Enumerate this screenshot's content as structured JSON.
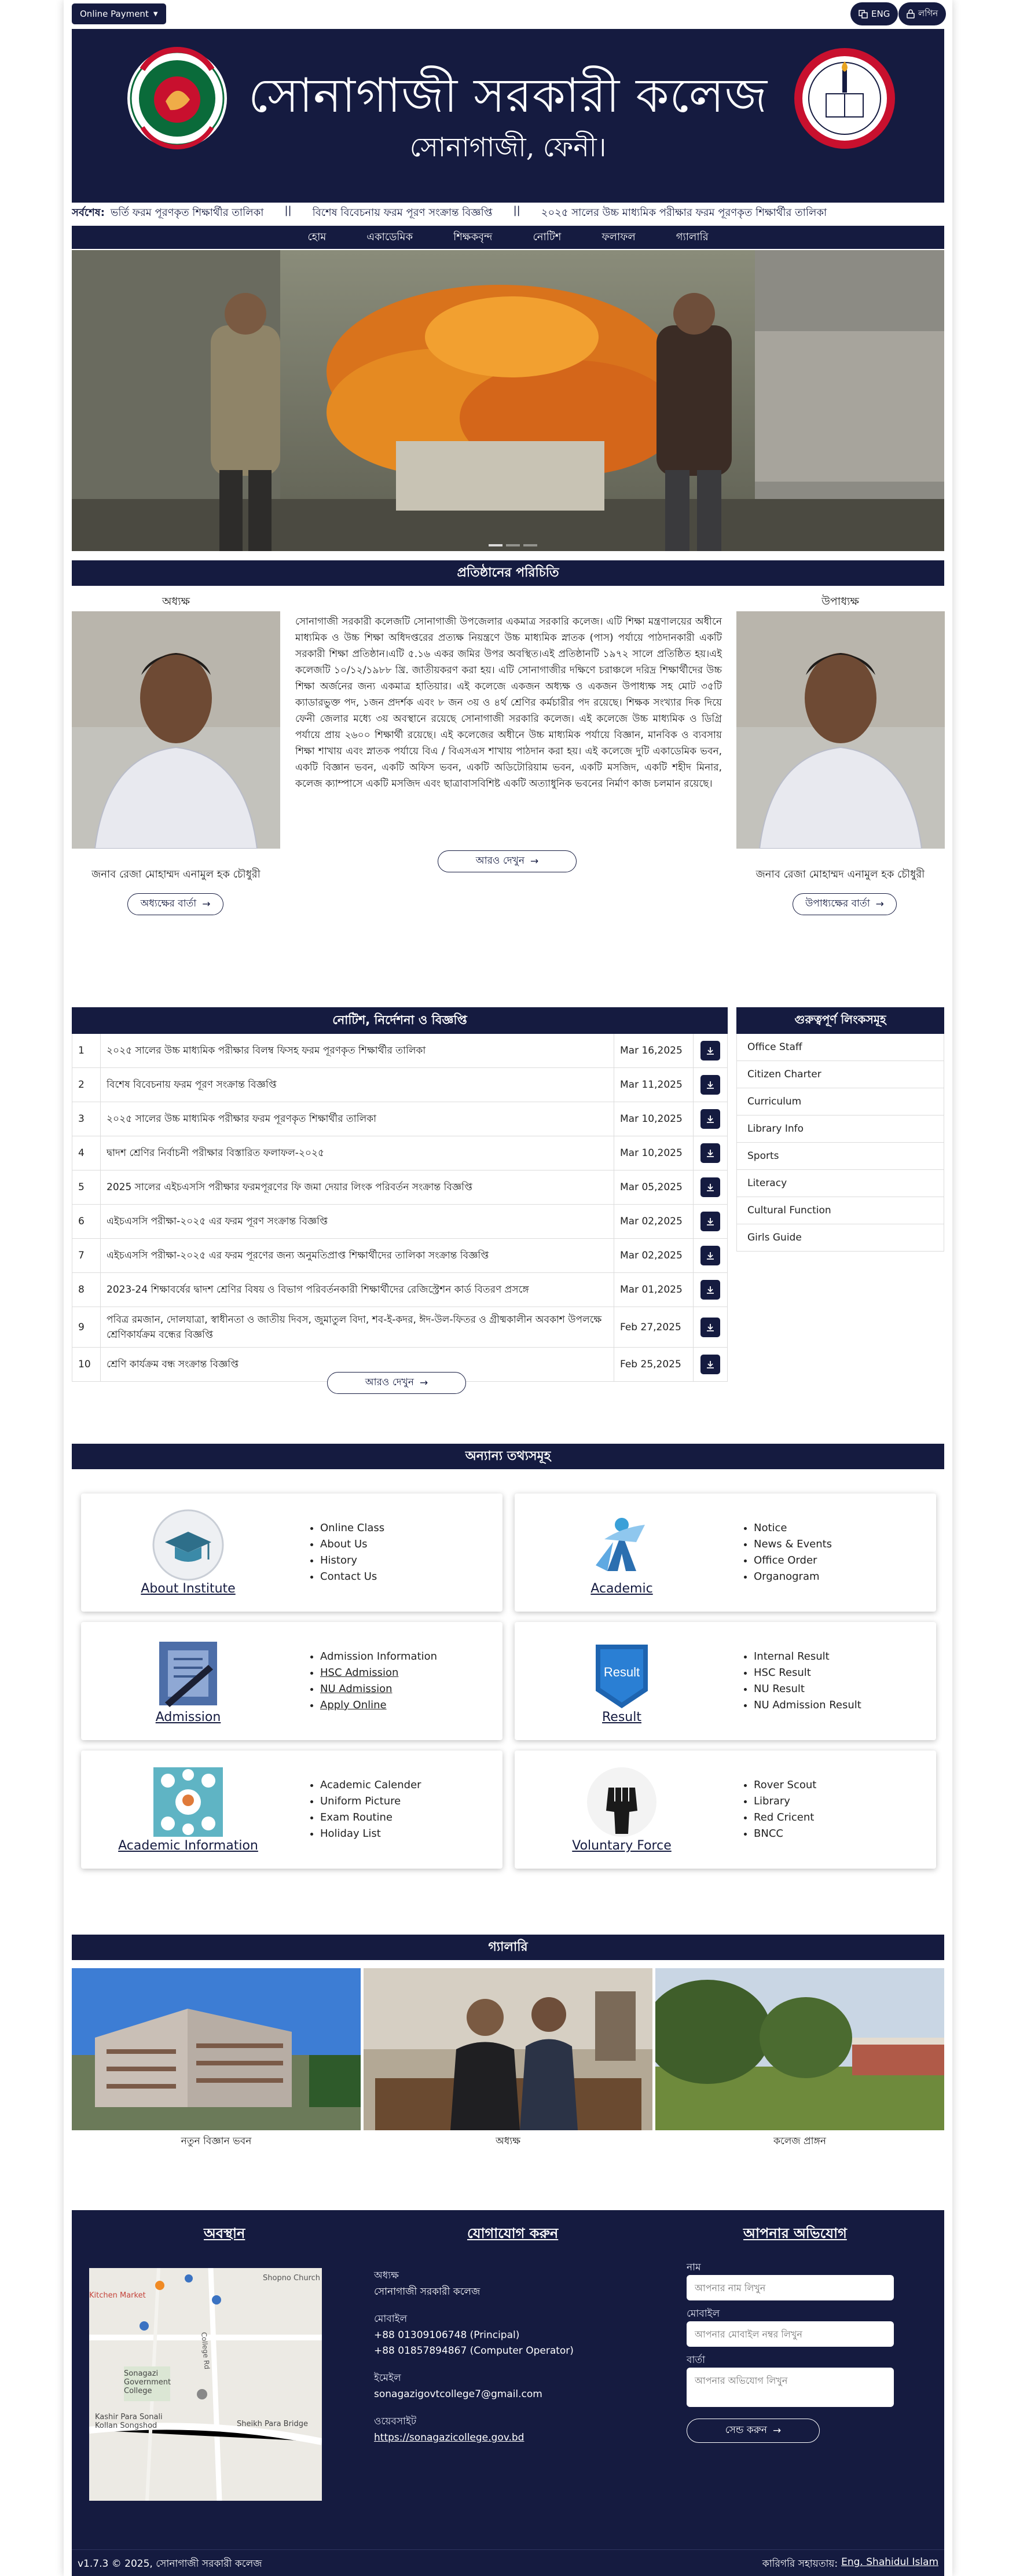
{
  "topbar": {
    "payment_label": "Online Payment",
    "lang_label": "ENG",
    "login_label": "লগিন"
  },
  "header": {
    "title": "সোনাগাজী সরকারী কলেজ",
    "subtitle": "সোনাগাজী, ফেনী।"
  },
  "ticker": {
    "label": "সর্বশেষ:",
    "items": [
      "ভর্তি ফরম পূরণকৃত শিক্ষার্থীর তালিকা",
      "||",
      "বিশেষ বিবেচনায় ফরম পূরণ সংক্রান্ত বিজ্ঞপ্তি",
      "||",
      "২০২৫ সালের উচ্চ মাধ্যমিক পরীক্ষার ফরম পূরণকৃত শিক্ষার্থীর তালিকা"
    ]
  },
  "menu": [
    "হোম",
    "একাডেমিক",
    "শিক্ষকবৃন্দ",
    "নোটিশ",
    "ফলাফল",
    "গ্যালারি"
  ],
  "intro": {
    "section_title": "প্রতিষ্ঠানের পরিচিতি",
    "principal": {
      "role": "অধ্যক্ষ",
      "name": "জনাব রেজা মোহাম্মদ এনামুল হক চৌধুরী",
      "button": "অধ্যক্ষের বার্তা"
    },
    "vice_principal": {
      "role": "উপাধ্যক্ষ",
      "name": "জনাব রেজা মোহাম্মদ এনামুল হক চৌধুরী",
      "button": "উপাধ্যক্ষের বার্তা"
    },
    "text": "সোনাগাজী সরকারী কলেজটি সোনাগাজী উপজেলার একমাত্র সরকারি কলেজ। এটি শিক্ষা মন্ত্রণালয়ের অধীনে মাধ্যমিক ও উচ্চ শিক্ষা অধিদপ্তরের প্রত্যক্ষ নিয়ন্ত্রণে উচ্চ মাধ্যমিক স্নাতক (পাস) পর্যায়ে পাঠদানকারী একটি সরকারী শিক্ষা প্রতিষ্ঠান।এটি ৫.১৬ একর জমির উপর অবস্থিত।এই প্রতিষ্ঠানটি ১৯৭২ সালে প্রতিষ্ঠিত হয়।এই কলেজটি ১০/১২/১৯৮৮ খ্রি. জাতীয়করণ করা হয়। এটি সোনাগাজীর দক্ষিণে চরাঞ্চলে দরিদ্র শিক্ষার্থীদের উচ্চ শিক্ষা অর্জনের জন্য একমাত্র হাতিয়ার। এই কলেজে একজন অধ্যক্ষ ও একজন উপাধ্যক্ষ সহ মোট ৩৫টি ক্যাডারভুক্ত পদ, ১জন প্রদর্শক এবং ৮ জন ৩য় ও ৪র্থ শ্রেণির কর্মচারীর পদ রয়েছে। শিক্ষক সংখ্যার দিক দিয়ে ফেনী জেলার মধ্যে ৩য় অবস্থানে রয়েছে সোনাগাজী সরকারি কলেজ। এই কলেজে উচ্চ মাধ্যমিক ও ডিগ্রি পর্যায়ে প্রায় ২৬০০ শিক্ষার্থী রয়েছে। এই কলেজের অধীনে উচ্চ মাধ্যমিক পর্যায়ে বিজ্ঞান, মানবিক ও ব্যবসায় শিক্ষা শাখায় এবং স্নাতক পর্যায়ে বিএ / বিএসএস শাখায় পাঠদান করা হয়। এই কলেজে দুটি একাডেমিক ভবন, একটি বিজ্ঞান ভবন, একটি অফিস ভবন, একটি অডিটোরিয়াম ভবন, একটি মসজিদ, একটি শহীদ মিনার, কলেজ ক্যাম্পাসে একটি মসজিদ এবং ছাত্রাবাসবিশিষ্ট একটি অত্যাধুনিক ভবনের নির্মাণ কাজ চলমান রয়েছে।",
    "more_button": "আরও দেখুন"
  },
  "notices": {
    "title": "নোটিশ, নির্দেশনা ও বিজ্ঞপ্তি",
    "rows": [
      {
        "no": "1",
        "title": "২০২৫ সালের উচ্চ মাধ্যমিক পরীক্ষার বিলম্ব ফিসহ ফরম পূরণকৃত শিক্ষার্থীর তালিকা",
        "date": "Mar 16,2025"
      },
      {
        "no": "2",
        "title": "বিশেষ বিবেচনায় ফরম পূরণ সংক্রান্ত বিজ্ঞপ্তি",
        "date": "Mar 11,2025"
      },
      {
        "no": "3",
        "title": "২০২৫ সালের উচ্চ মাধ্যমিক পরীক্ষার ফরম পূরণকৃত শিক্ষার্থীর তালিকা",
        "date": "Mar 10,2025"
      },
      {
        "no": "4",
        "title": "দ্বাদশ শ্রেণির নির্বাচনী পরীক্ষার বিস্তারিত ফলাফল-২০২৫",
        "date": "Mar 10,2025"
      },
      {
        "no": "5",
        "title": "2025 সালের এইচএসসি পরীক্ষার ফরমপূরণের ফি জমা দেয়ার লিংক পরিবর্তন সংক্রান্ত বিজ্ঞপ্তি",
        "date": "Mar 05,2025"
      },
      {
        "no": "6",
        "title": "এইচএসসি পরীক্ষা-২০২৫ এর ফরম পূরণ সংক্রান্ত বিজ্ঞপ্তি",
        "date": "Mar 02,2025"
      },
      {
        "no": "7",
        "title": "এইচএসসি পরীক্ষা-২০২৫ এর ফরম পূরণের জন্য অনুমতিপ্রাপ্ত শিক্ষার্থীদের তালিকা সংক্রান্ত বিজ্ঞপ্তি",
        "date": "Mar 02,2025"
      },
      {
        "no": "8",
        "title": "2023-24 শিক্ষাবর্ষের দ্বাদশ শ্রেণির বিষয় ও বিভাগ পরিবর্তনকারী শিক্ষার্থীদের রেজিস্ট্রেশন কার্ড বিতরণ প্রসঙ্গে",
        "date": "Mar 01,2025"
      },
      {
        "no": "9",
        "title": "পবিত্র রমজান, দোলযাত্রা, স্বাধীনতা ও জাতীয় দিবস, জুমাতুল বিদা, শব-ই-কদর, ঈদ-উল-ফিতর ও গ্রীষ্মকালীন অবকাশ উপলক্ষে শ্রেণিকার্যক্রম বন্ধের বিজ্ঞপ্তি",
        "date": "Feb 27,2025"
      },
      {
        "no": "10",
        "title": "শ্রেণি কার্যক্রম বন্ধ সংক্রান্ত বিজ্ঞপ্তি",
        "date": "Feb 25,2025"
      }
    ],
    "more_button": "আরও দেখুন"
  },
  "links": {
    "title": "গুরুত্বপূর্ণ লিংকসমূহ",
    "items": [
      "Office Staff",
      "Citizen Charter",
      "Curriculum",
      "Library Info",
      "Sports",
      "Literacy",
      "Cultural Function",
      "Girls Guide"
    ]
  },
  "other_info": {
    "title": "অন্যান্য তথ্যসমূহ",
    "cards": [
      {
        "label": "About Institute",
        "icon": "graduation-cap-icon",
        "items": [
          "Online Class",
          "About Us",
          "History",
          "Contact Us"
        ]
      },
      {
        "label": "Academic",
        "icon": "academic-figure-icon",
        "items": [
          "Notice",
          "News & Events",
          "Office Order",
          "Organogram"
        ]
      },
      {
        "label": "Admission",
        "icon": "document-pen-icon",
        "items": [
          "Admission Information",
          "HSC Admission",
          "NU Admission",
          "Apply Online"
        ]
      },
      {
        "label": "Result",
        "icon": "result-badge-icon",
        "items": [
          "Internal Result",
          "HSC Result",
          "NU Result",
          "NU Admission Result"
        ]
      },
      {
        "label": "Academic Information",
        "icon": "academic-info-icon",
        "items": [
          "Academic Calender",
          "Uniform Picture",
          "Exam Routine",
          "Holiday List"
        ]
      },
      {
        "label": "Voluntary Force",
        "icon": "raised-fist-icon",
        "items": [
          "Rover Scout",
          "Library",
          "Red Cricent",
          "BNCC"
        ]
      }
    ]
  },
  "gallery": {
    "title": "গ্যালারি",
    "items": [
      {
        "caption": "নতুন বিজ্ঞান ভবন"
      },
      {
        "caption": "অধ্যক্ষ"
      },
      {
        "caption": "কলেজ প্রাঙ্গন"
      }
    ]
  },
  "footer": {
    "location_title": "অবস্থান",
    "contact_title": "যোগাযোগ করুন",
    "complaint_title": "আপনার অভিযোগ",
    "map_labels": [
      "Kitchen Market",
      "Shopno Church",
      "Sonagazi Government College",
      "Kashir Para Sonali Kollan Songshod",
      "Sheikh Para Bridge",
      "College Rd"
    ],
    "contact": {
      "principal_label": "অধ্যক্ষ",
      "principal_value": "সোনাগাজী সরকারী কলেজ",
      "mobile_label": "মোবাইল",
      "mobile_1": "+88 01309106748 (Principal)",
      "mobile_2": "+88 01857894867 (Computer Operator)",
      "email_label": "ইমেইল",
      "email_value": "sonagazigovtcollege7@gmail.com",
      "website_label": "ওয়েবসাইট",
      "website_value": "https://sonagazicollege.gov.bd"
    },
    "form": {
      "name_label": "নাম",
      "name_placeholder": "আপনার নাম লিখুন",
      "mobile_label": "মোবাইল",
      "mobile_placeholder": "আপনার মোবাইল নম্বর লিখুন",
      "message_label": "বার্তা",
      "message_placeholder": "আপনার অভিযোগ লিখুন",
      "send_button": "সেন্ড করুন"
    },
    "version": "v1.7.3 © 2025, সোনাগাজী সরকারী কলেজ",
    "credit_label": "কারিগরি সহায়তায়:",
    "credit_name": "Eng. Shahidul Islam"
  },
  "colors": {
    "navy": "#151b40",
    "accent_red": "#c8102e",
    "accent_green": "#0a6b3a"
  }
}
